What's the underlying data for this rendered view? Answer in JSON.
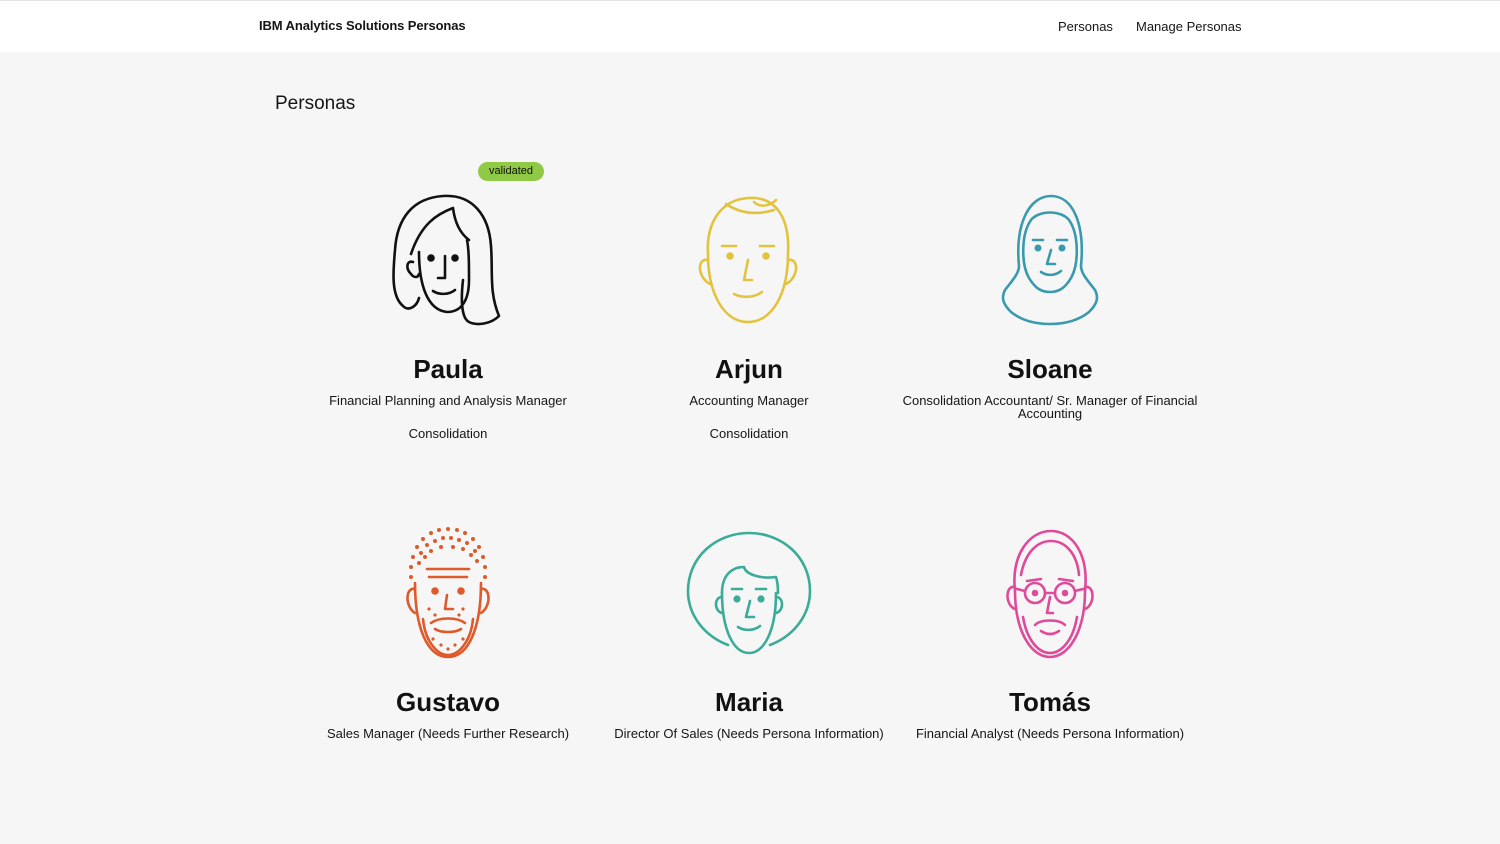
{
  "header": {
    "brand": "IBM Analytics Solutions Personas",
    "nav": [
      "Personas",
      "Manage Personas"
    ]
  },
  "page": {
    "title": "Personas"
  },
  "personas": [
    {
      "name": "Paula",
      "role": "Financial Planning and Analysis Manager",
      "category": "Consolidation",
      "badge": "validated",
      "color": "#111111",
      "icon": "woman-long-hair-icon"
    },
    {
      "name": "Arjun",
      "role": "Accounting Manager",
      "category": "Consolidation",
      "color": "#e3c33e",
      "icon": "man-short-hair-icon"
    },
    {
      "name": "Sloane",
      "role": "Consolidation Accountant/ Sr. Manager of Financial Accounting",
      "category": "",
      "color": "#3a9aad",
      "icon": "woman-hijab-icon"
    },
    {
      "name": "Gustavo",
      "role": "Sales Manager (Needs Further Research)",
      "category": "",
      "color": "#de5a2a",
      "icon": "man-beard-icon"
    },
    {
      "name": "Maria",
      "role": "Director Of Sales (Needs Persona Information)",
      "category": "",
      "color": "#3aac98",
      "icon": "woman-afro-icon"
    },
    {
      "name": "Tomás",
      "role": "Financial Analyst (Needs Persona Information)",
      "category": "",
      "color": "#df4a9a",
      "icon": "man-glasses-icon"
    }
  ]
}
